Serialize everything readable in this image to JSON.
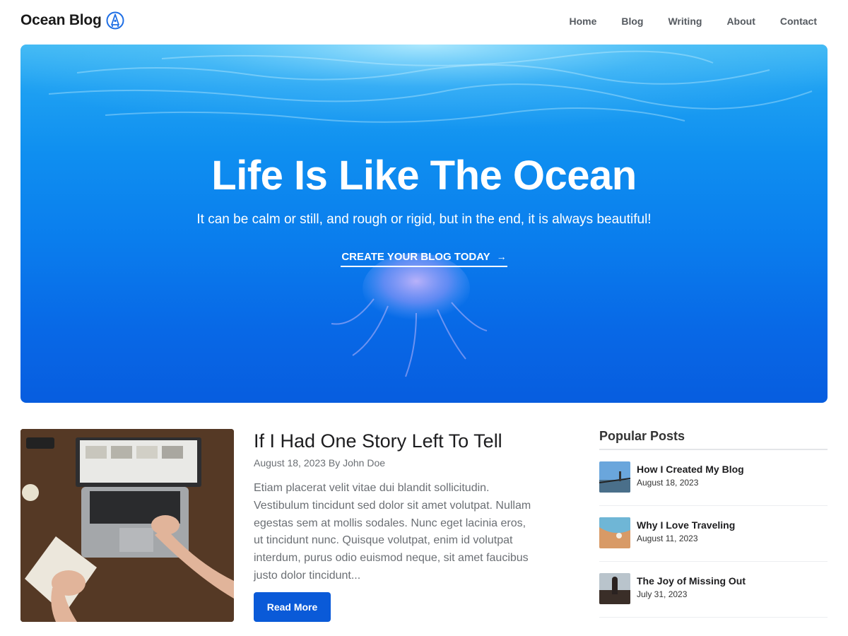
{
  "header": {
    "logo_text": "Ocean Blog",
    "nav": [
      "Home",
      "Blog",
      "Writing",
      "About",
      "Contact"
    ]
  },
  "hero": {
    "title": "Life Is Like The Ocean",
    "subtitle": "It can be calm or still, and rough or rigid, but in the end, it is always beautiful!",
    "cta_label": "CREATE YOUR BLOG TODAY",
    "cta_icon": "arrow-right-icon"
  },
  "post": {
    "title": "If I Had One Story Left To Tell",
    "meta": "August 18, 2023 By John Doe",
    "excerpt": "Etiam placerat velit vitae dui blandit sollicitudin. Vestibulum tincidunt sed dolor sit amet volutpat. Nullam egestas sem at mollis sodales. Nunc eget lacinia eros, ut tincidunt nunc. Quisque volutpat, enim id volutpat interdum, purus odio euismod neque, sit amet faucibus justo dolor tincidunt...",
    "read_more": "Read More"
  },
  "sidebar": {
    "title": "Popular Posts",
    "items": [
      {
        "title": "How I Created My Blog",
        "date": "August 18, 2023"
      },
      {
        "title": "Why I Love Traveling",
        "date": "August 11, 2023"
      },
      {
        "title": "The Joy of Missing Out",
        "date": "July 31, 2023"
      }
    ]
  },
  "colors": {
    "accent": "#0a5ad8",
    "hero_top": "#3fb8f3",
    "hero_bottom": "#075ddf"
  }
}
